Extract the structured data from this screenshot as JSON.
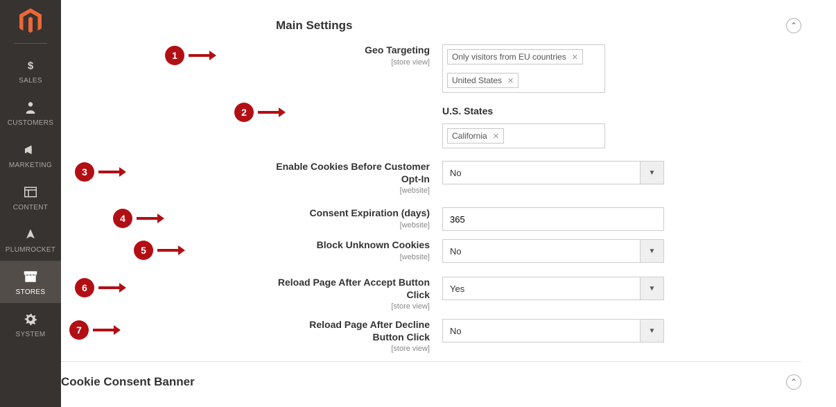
{
  "sidebar": {
    "items": [
      {
        "label": "SALES"
      },
      {
        "label": "CUSTOMERS"
      },
      {
        "label": "MARKETING"
      },
      {
        "label": "CONTENT"
      },
      {
        "label": "PLUMROCKET"
      },
      {
        "label": "STORES"
      },
      {
        "label": "SYSTEM"
      }
    ]
  },
  "main": {
    "section1_title": "Main Settings",
    "section2_title": "Cookie Consent Banner",
    "rows": {
      "geo_targeting": {
        "label": "Geo Targeting",
        "scope": "[store view]",
        "tags": [
          "Only visitors from EU countries",
          "United States"
        ]
      },
      "us_states": {
        "label": "U.S. States",
        "tags": [
          "California"
        ]
      },
      "enable_before_optin": {
        "label": "Enable Cookies Before Customer Opt-In",
        "scope": "[website]",
        "value": "No"
      },
      "consent_expiration": {
        "label": "Consent Expiration (days)",
        "scope": "[website]",
        "value": "365"
      },
      "block_unknown": {
        "label": "Block Unknown Cookies",
        "scope": "[website]",
        "value": "No"
      },
      "reload_accept": {
        "label": "Reload Page After Accept Button Click",
        "scope": "[store view]",
        "value": "Yes"
      },
      "reload_decline": {
        "label": "Reload Page After Decline Button Click",
        "scope": "[store view]",
        "value": "No"
      }
    },
    "annotations": {
      "a1": "1",
      "a2": "2",
      "a3": "3",
      "a4": "4",
      "a5": "5",
      "a6": "6",
      "a7": "7"
    }
  }
}
